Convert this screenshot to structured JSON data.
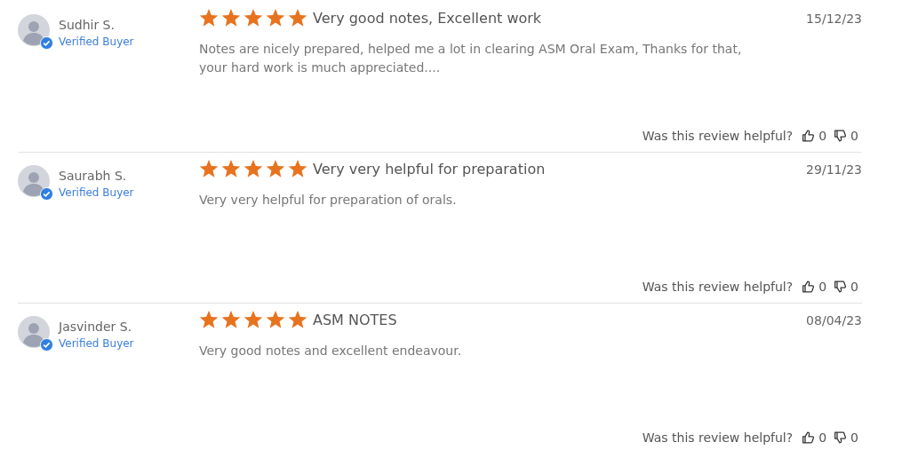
{
  "reviews": [
    {
      "name": "Sudhir S.",
      "badge": "Verified Buyer",
      "stars": 5,
      "title": "Very good notes, Excellent work",
      "date": "15/12/23",
      "body": "Notes are nicely prepared, helped me a lot in clearing ASM Oral Exam, Thanks for that, your hard work is much appreciated....",
      "helpful_label": "Was this review helpful?",
      "up": "0",
      "down": "0"
    },
    {
      "name": "Saurabh S.",
      "badge": "Verified Buyer",
      "stars": 5,
      "title": "Very very helpful for preparation",
      "date": "29/11/23",
      "body": "Very very helpful for preparation of orals.",
      "helpful_label": "Was this review helpful?",
      "up": "0",
      "down": "0"
    },
    {
      "name": "Jasvinder S.",
      "badge": "Verified Buyer",
      "stars": 5,
      "title": "ASM NOTES",
      "date": "08/04/23",
      "body": "Very good notes and excellent endeavour.",
      "helpful_label": "Was this review helpful?",
      "up": "0",
      "down": "0"
    }
  ]
}
